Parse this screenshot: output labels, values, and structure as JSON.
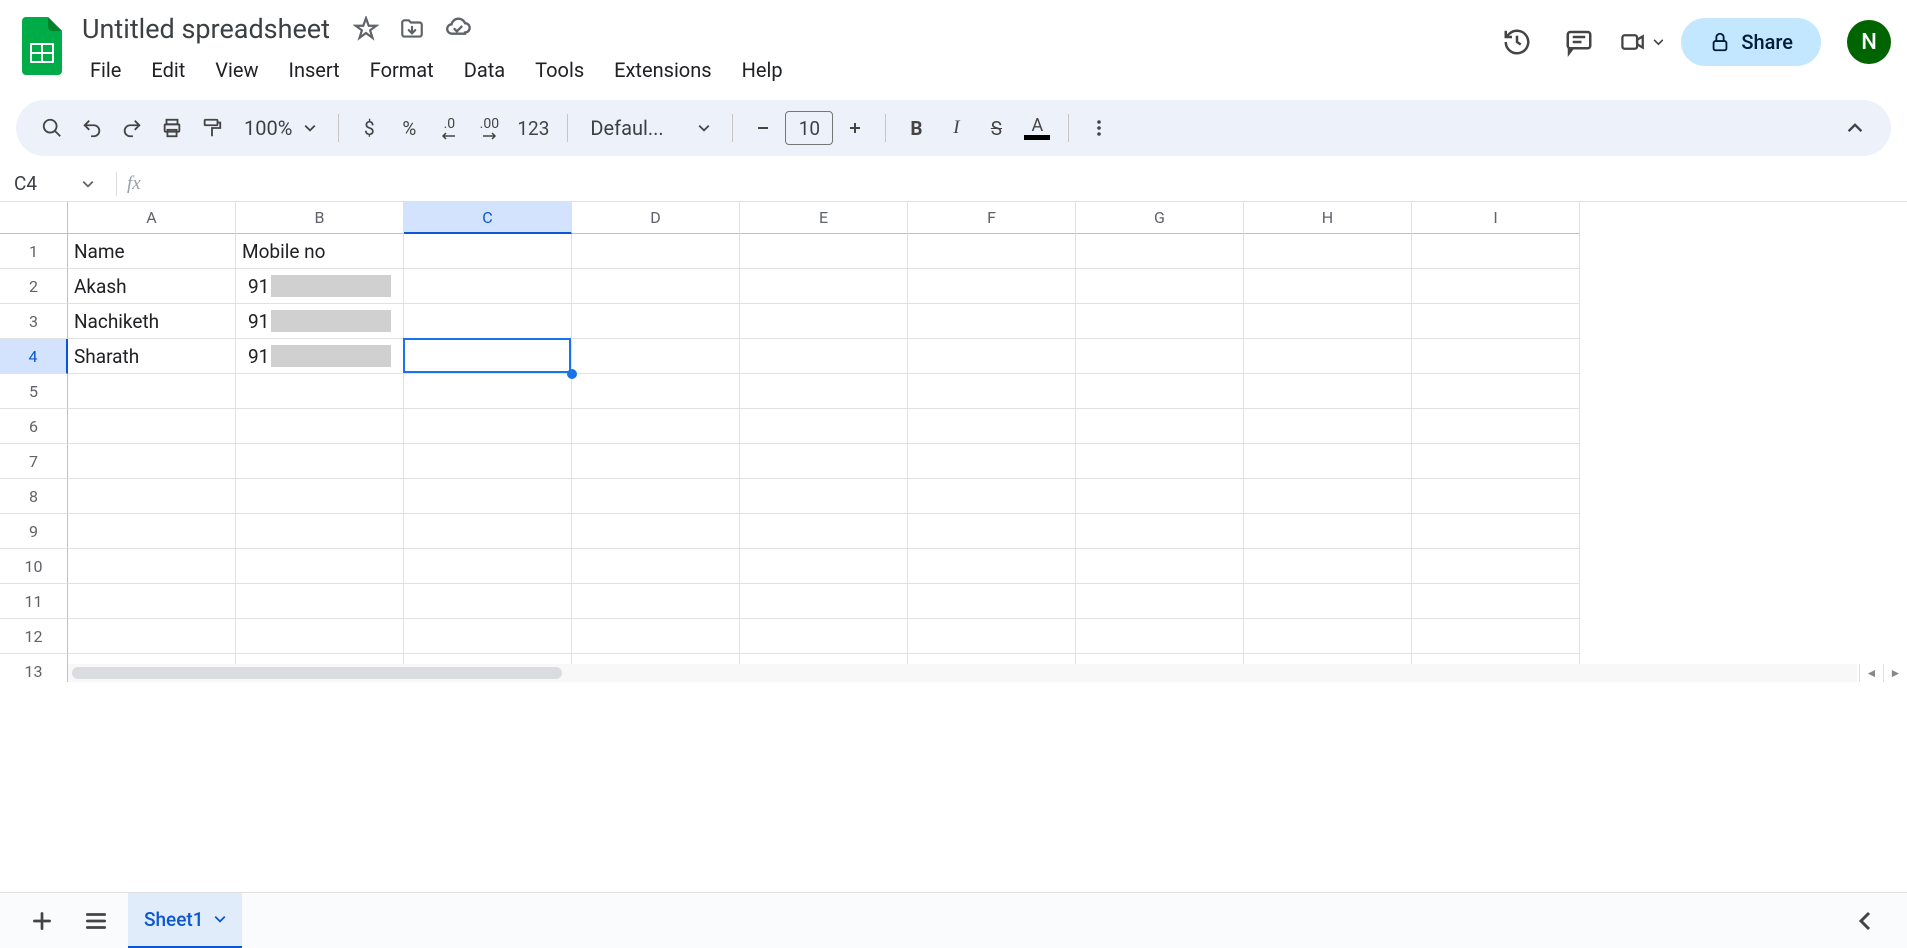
{
  "header": {
    "title": "Untitled spreadsheet",
    "menus": [
      "File",
      "Edit",
      "View",
      "Insert",
      "Format",
      "Data",
      "Tools",
      "Extensions",
      "Help"
    ],
    "share_label": "Share",
    "avatar_initial": "N"
  },
  "toolbar": {
    "zoom": "100%",
    "currency": "$",
    "percent": "%",
    "decrease_decimal": ".0",
    "increase_decimal": ".00",
    "num_format": "123",
    "font_name": "Defaul...",
    "font_size": "10",
    "bold": "B",
    "italic": "I",
    "strike": "S",
    "text_color": "A"
  },
  "formula_bar": {
    "name_box": "C4",
    "fx": "fx"
  },
  "grid": {
    "columns": [
      "A",
      "B",
      "C",
      "D",
      "E",
      "F",
      "G",
      "H",
      "I"
    ],
    "rows": [
      "1",
      "2",
      "3",
      "4",
      "5",
      "6",
      "7",
      "8",
      "9",
      "10",
      "11",
      "12",
      "13"
    ],
    "selected_col": "C",
    "selected_row": "4",
    "data": {
      "A1": "Name",
      "B1": "Mobile no",
      "A2": "Akash",
      "B2": "91",
      "A3": "Nachiketh",
      "B3": "91",
      "A4": "Sharath",
      "B4": "91"
    }
  },
  "sheet_bar": {
    "active_tab": "Sheet1"
  }
}
